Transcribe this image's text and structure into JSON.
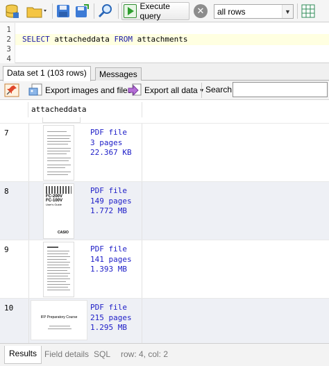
{
  "toolbar": {
    "execute_label": "Execute query",
    "rows_select_value": "all rows",
    "icons": [
      "database-icon",
      "open-folder-icon",
      "save-disk-icon",
      "save-as-disk-icon",
      "search-icon",
      "execute-icon",
      "stop-icon",
      "grid-icon"
    ]
  },
  "editor": {
    "line_numbers": [
      "1",
      "2",
      "3",
      "4"
    ],
    "query": {
      "kw_select": "SELECT",
      "column": " attacheddata ",
      "kw_from": "FROM",
      "table": " attachments"
    }
  },
  "tabs": [
    {
      "label": "Data set 1 (103 rows)",
      "active": true
    },
    {
      "label": "Messages",
      "active": false
    }
  ],
  "grid_toolbar": {
    "export_images_label": "Export images and files",
    "export_all_label": "Export all data",
    "search_label": "Search",
    "search_value": ""
  },
  "grid": {
    "column_header": "attacheddata",
    "rows": [
      {
        "num": "7",
        "type": "PDF file",
        "pages": "3 pages",
        "size": "22.367 KB"
      },
      {
        "num": "8",
        "type": "PDF file",
        "pages": "149 pages",
        "size": "1.772 MB",
        "thumb_text": [
          "FC-200V",
          "FC-100V",
          "User's Guide",
          "CASIO"
        ]
      },
      {
        "num": "9",
        "type": "PDF file",
        "pages": "141 pages",
        "size": "1.393 MB"
      },
      {
        "num": "10",
        "type": "PDF file",
        "pages": "215 pages",
        "size": "1.295 MB",
        "thumb_text": [
          "IFP Preparatory Course"
        ]
      }
    ]
  },
  "bottom_tabs": {
    "results": "Results",
    "field_details": "Field details",
    "sql": "SQL",
    "status": "row: 4, col: 2"
  },
  "colors": {
    "accent_text": "#2020c8",
    "sql_keyword": "#1a1aa6",
    "alt_row": "#eef0f5",
    "current_line": "#ffffe1"
  }
}
